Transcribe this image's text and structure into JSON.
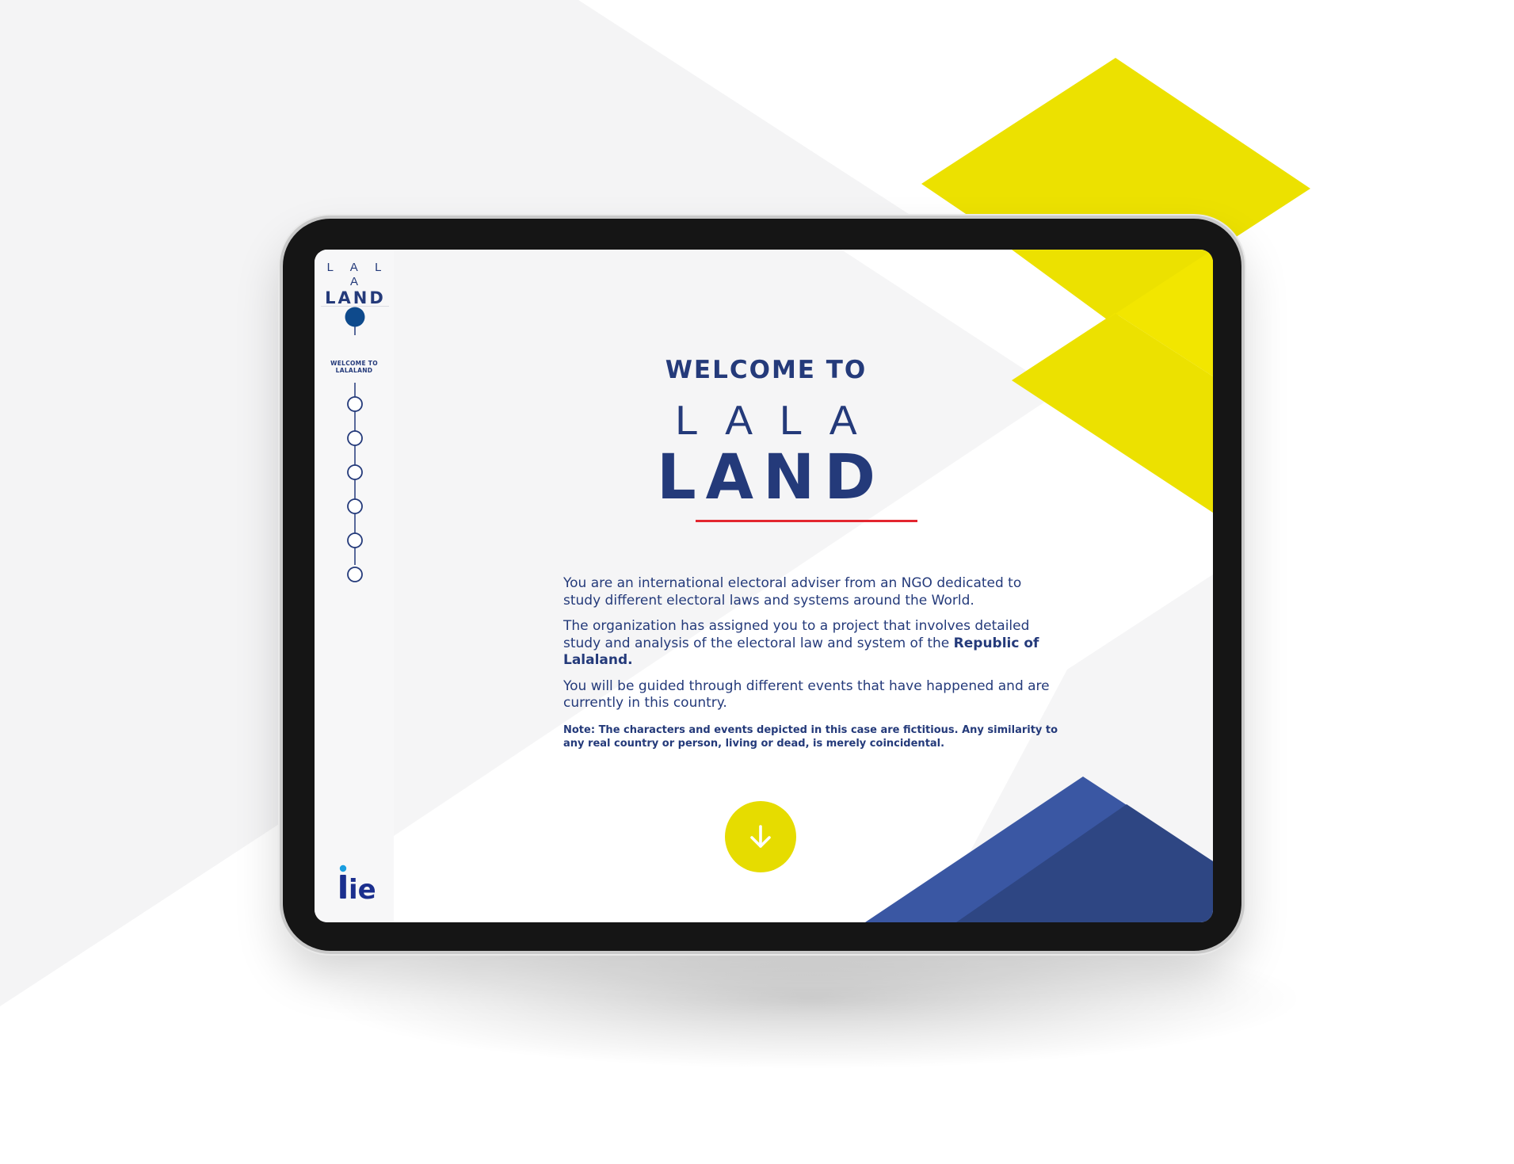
{
  "theme": {
    "navy": "#243a7a",
    "accent_yellow": "#e6dc00",
    "accent_red": "#e3262f",
    "blue_shape": "#3a57a3",
    "blue_shape_dark": "#2e4683"
  },
  "sidebar": {
    "logo_top": "L A L A",
    "logo_bottom": "LAND",
    "active_step_label_line1": "WELCOME TO",
    "active_step_label_line2": "LALALAND",
    "step_count": 7,
    "active_step_index": 0,
    "footer_logo_text": "ie"
  },
  "main": {
    "welcome": "WELCOME TO",
    "title_top": "LALA",
    "title_bottom": "LAND",
    "paragraph1": "You are an international electoral adviser from an NGO dedicated to study different electoral laws and systems around the World.",
    "paragraph2_pre": "The organization has assigned you to a project that involves detailed study and analysis of the electoral law and system of the ",
    "paragraph2_strong": "Republic of Lalaland.",
    "paragraph3": "You will be guided through different events that have happened and are currently in this country.",
    "note": "Note: The characters and events depicted in this case are fictitious. Any similarity to any real country or person, living or dead, is merely coincidental.",
    "down_icon": "arrow-down-icon"
  }
}
